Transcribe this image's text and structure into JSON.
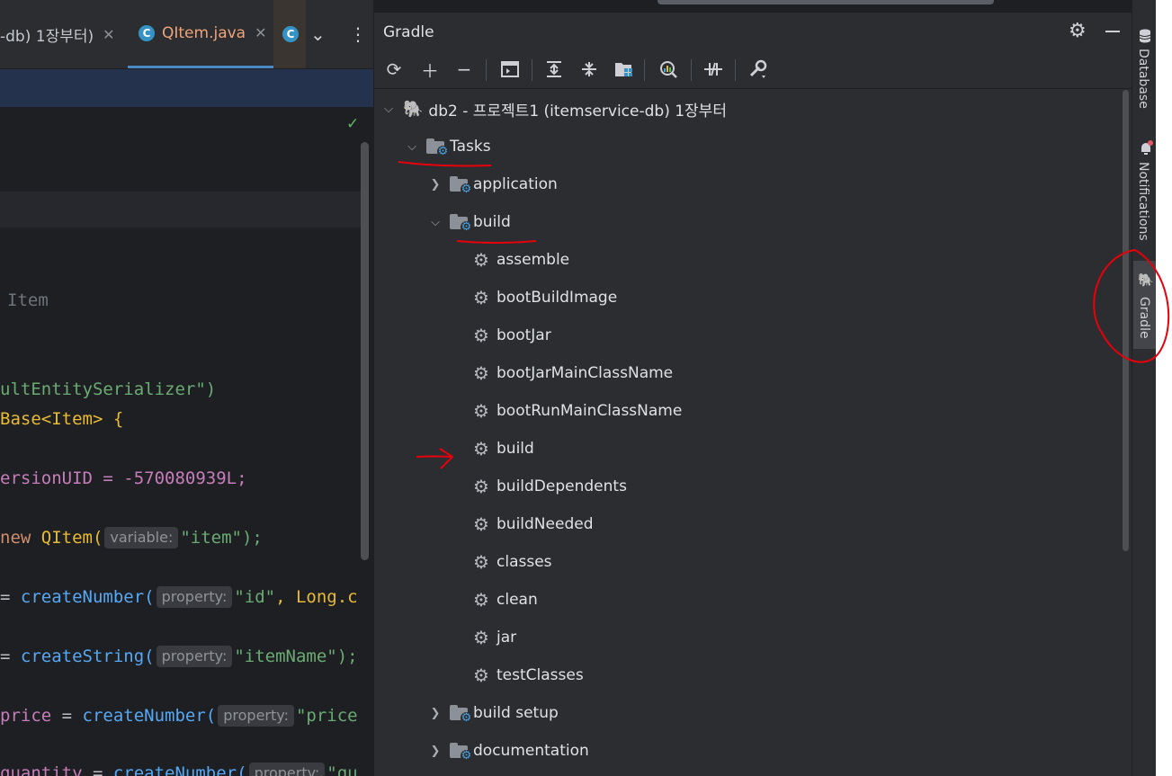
{
  "editor": {
    "tabs": [
      {
        "label": "-db) 1장부터)",
        "close": "✕"
      },
      {
        "label": "QItem.java",
        "close": "✕",
        "icon": "C"
      },
      {
        "icon": "C"
      }
    ],
    "tabs_more": "⌄",
    "tabs_menu": "⋮",
    "inspection_ok": "✓",
    "code_lines": [
      {
        "t": "Item"
      },
      {
        "t": "ultEntitySerializer\")"
      },
      {
        "t": "Base<Item> {"
      },
      {
        "a": "ersionUID = -570080939L;"
      },
      {
        "a": "new ",
        "b": "QItem(",
        "hint": "variable:",
        "c": "\"item\");"
      },
      {
        "a": "= ",
        "b": "createNumber(",
        "hint": "property:",
        "c": "\"id\"",
        "d": ", Long.c"
      },
      {
        "a": "= ",
        "b": "createString(",
        "hint": "property:",
        "c": "\"itemName\");"
      },
      {
        "a": "price",
        "eq": " = ",
        "b": "createNumber(",
        "hint": "property:",
        "c": "\"price"
      },
      {
        "a": "quantity",
        "eq": " = ",
        "b": "createNumber(",
        "hint": "property:",
        "c": "\"qu"
      }
    ]
  },
  "gradle": {
    "title": "Gradle",
    "header_icons": [
      "gear-icon",
      "minimize-icon"
    ],
    "toolbar": [
      "refresh-icon",
      "add-icon",
      "remove-icon",
      "run-task-icon",
      "expand-all-icon",
      "collapse-all-icon",
      "dependencies-icon",
      "analyze-icon",
      "toggle-offline-icon",
      "settings-wrench-icon"
    ],
    "tree": {
      "project": "db2 - 프로젝트1 (itemservice-db) 1장부터",
      "tasks": "Tasks",
      "groups": [
        {
          "label": "application",
          "expanded": false
        },
        {
          "label": "build",
          "expanded": true,
          "tasks": [
            "assemble",
            "bootBuildImage",
            "bootJar",
            "bootJarMainClassName",
            "bootRunMainClassName",
            "build",
            "buildDependents",
            "buildNeeded",
            "classes",
            "clean",
            "jar",
            "testClasses"
          ]
        },
        {
          "label": "build setup",
          "expanded": false
        },
        {
          "label": "documentation",
          "expanded": false
        }
      ]
    }
  },
  "side_strip": {
    "database": "Database",
    "notifications": "Notifications",
    "gradle": "Gradle"
  },
  "colors": {
    "annotation": "#e8000b",
    "accent": "#4a88c7"
  }
}
